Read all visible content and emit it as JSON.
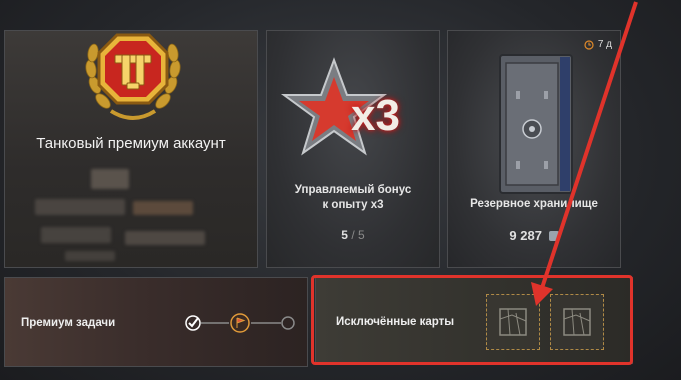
{
  "premium_card": {
    "title": "Танковый премиум аккаунт"
  },
  "bonus_card": {
    "badge_text": "x3",
    "title_line1": "Управляемый бонус",
    "title_line2": "к опыту x3",
    "count_current": "5",
    "count_sep": "/",
    "count_total": "5"
  },
  "vault_card": {
    "timer": "7 д",
    "title": "Резервное хранилище",
    "amount": "9 287"
  },
  "tasks_row": {
    "label": "Премиум задачи"
  },
  "maps_row": {
    "label": "Исключённые карты"
  },
  "colors": {
    "gold": "#e8b43a",
    "red_star": "#d63a2e",
    "highlight": "#e0332b"
  }
}
